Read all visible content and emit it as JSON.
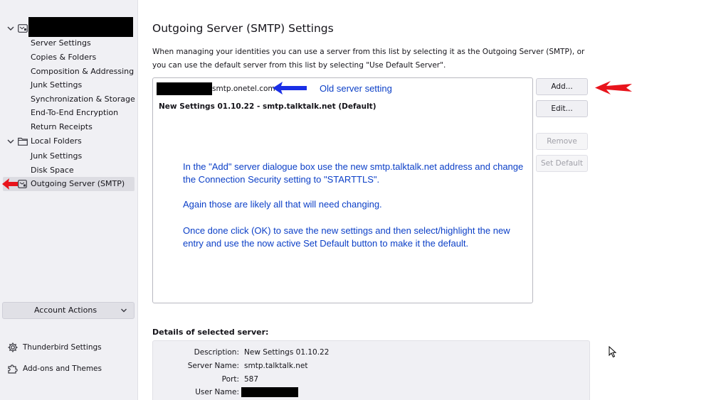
{
  "sidebar": {
    "account_items": [
      "Server Settings",
      "Copies & Folders",
      "Composition & Addressing",
      "Junk Settings",
      "Synchronization & Storage",
      "End-To-End Encryption",
      "Return Receipts"
    ],
    "local_folders": {
      "label": "Local Folders",
      "items": [
        "Junk Settings",
        "Disk Space"
      ]
    },
    "outgoing_server": "Outgoing Server (SMTP)",
    "account_actions": "Account Actions",
    "footer": {
      "settings": "Thunderbird Settings",
      "addons": "Add-ons and Themes"
    }
  },
  "main": {
    "title": "Outgoing Server (SMTP) Settings",
    "description": "When managing your identities you can use a server from this list by selecting it as the Outgoing Server (SMTP), or you can use the default server from this list by selecting \"Use Default Server\".",
    "servers": [
      {
        "host": "smtp.onetel.com"
      },
      {
        "label": "New Settings 01.10.22 - smtp.talktalk.net (Default)"
      }
    ],
    "buttons": {
      "add": "Add...",
      "edit": "Edit...",
      "remove": "Remove",
      "set_default": "Set Default"
    },
    "details": {
      "heading": "Details of selected server:",
      "description_label": "Description:",
      "description_value": "New Settings 01.10.22",
      "server_name_label": "Server Name:",
      "server_name_value": "smtp.talktalk.net",
      "port_label": "Port:",
      "port_value": "587",
      "user_name_label": "User Name:"
    }
  },
  "annotations": {
    "old_server": "Old server setting",
    "instructions_1": "In the \"Add\" server dialogue box use the new smtp.talktalk.net address and change the Connection Security setting to \"STARTTLS\".",
    "instructions_2": "Again those are likely all that will need changing.",
    "instructions_3": "Once done click (OK) to save the new settings and then select/highlight the new entry and use the now active Set Default button to make it the default.",
    "colors": {
      "text": "#0b3fc7",
      "blue_arrow": "#1a2fe6",
      "red_arrow": "#e8141c"
    }
  },
  "icons": {
    "account": "email-account-icon",
    "folder": "folder-icon",
    "smtp": "outgoing-server-icon",
    "settings": "gear-icon",
    "addons": "puzzle-icon"
  }
}
